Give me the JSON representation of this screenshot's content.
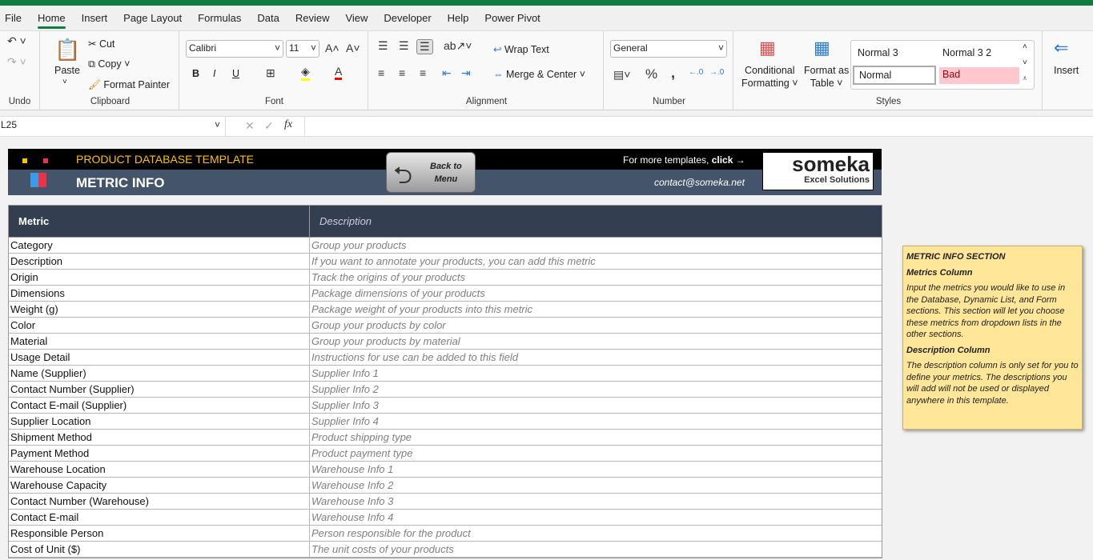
{
  "ribbon_tabs": [
    "File",
    "Home",
    "Insert",
    "Page Layout",
    "Formulas",
    "Data",
    "Review",
    "View",
    "Developer",
    "Help",
    "Power Pivot"
  ],
  "active_tab": "Home",
  "groups": {
    "undo": "Undo",
    "clipboard": "Clipboard",
    "font": "Font",
    "alignment": "Alignment",
    "number": "Number",
    "styles": "Styles"
  },
  "clipboard": {
    "paste": "Paste",
    "cut": "Cut",
    "copy": "Copy",
    "format_painter": "Format Painter"
  },
  "font": {
    "name": "Calibri",
    "size": "11",
    "bold": "B",
    "italic": "I",
    "underline": "U"
  },
  "alignment": {
    "wrap_text": "Wrap Text",
    "merge_center": "Merge & Center"
  },
  "number": {
    "format": "General",
    "percent": "%",
    "comma": ","
  },
  "styles": {
    "conditional_formatting": [
      "Conditional",
      "Formatting"
    ],
    "format_as_table": [
      "Format as",
      "Table"
    ],
    "normal3": "Normal 3",
    "normal32": "Normal 3 2",
    "normal": "Normal",
    "bad": "Bad"
  },
  "cells": {
    "insert": "Insert"
  },
  "formula_bar": {
    "name_box": "L25",
    "fx": "fx",
    "value": ""
  },
  "banner": {
    "template_title": "PRODUCT DATABASE TEMPLATE",
    "section_title": "METRIC INFO",
    "back_button": [
      "Back to",
      "Menu"
    ],
    "more_templates": "For more templates, ",
    "click": "click →",
    "contact": "contact@someka.net",
    "logo": "someka",
    "logo_sub": "Excel Solutions"
  },
  "colors": {
    "excel_green": "#107c41",
    "header_dark": "#333f50",
    "banner_slate": "#44546a",
    "title_orange": "#ffc000",
    "note_yellow": "#ffe699"
  },
  "table": {
    "headers": [
      "Metric",
      "Description"
    ],
    "rows": [
      [
        "Category",
        "Group your products"
      ],
      [
        "Description",
        "If you want to annotate your products, you can add this metric"
      ],
      [
        "Origin",
        "Track the origins of your products"
      ],
      [
        "Dimensions",
        "Package dimensions of your products"
      ],
      [
        "Weight (g)",
        "Package weight of your products into this metric"
      ],
      [
        "Color",
        "Group your products by color"
      ],
      [
        "Material",
        "Group your products by material"
      ],
      [
        "Usage Detail",
        "Instructions for use can be added to this field"
      ],
      [
        "Name (Supplier)",
        "Supplier Info 1"
      ],
      [
        "Contact Number (Supplier)",
        "Supplier Info 2"
      ],
      [
        "Contact E-mail (Supplier)",
        "Supplier Info 3"
      ],
      [
        "Supplier Location",
        "Supplier Info 4"
      ],
      [
        "Shipment Method",
        "Product shipping type"
      ],
      [
        "Payment Method",
        "Product payment type"
      ],
      [
        "Warehouse Location",
        "Warehouse Info 1"
      ],
      [
        "Warehouse Capacity",
        "Warehouse Info 2"
      ],
      [
        "Contact Number (Warehouse)",
        "Warehouse Info 3"
      ],
      [
        "Contact E-mail",
        "Warehouse Info 4"
      ],
      [
        "Responsible Person",
        "Person responsible for the product"
      ],
      [
        "Cost of Unit ($)",
        "The unit costs of your products"
      ]
    ]
  },
  "note": {
    "title": "METRIC INFO SECTION",
    "h1": "Metrics Column",
    "p1": "Input the metrics you would like to use in the Database, Dynamic List, and Form sections. This section will let you choose these metrics from dropdown lists in the other sections.",
    "h2": "Description Column",
    "p2": "The description column is only set for you to define your metrics. The descriptions you will add will not be used or displayed anywhere in this template."
  }
}
